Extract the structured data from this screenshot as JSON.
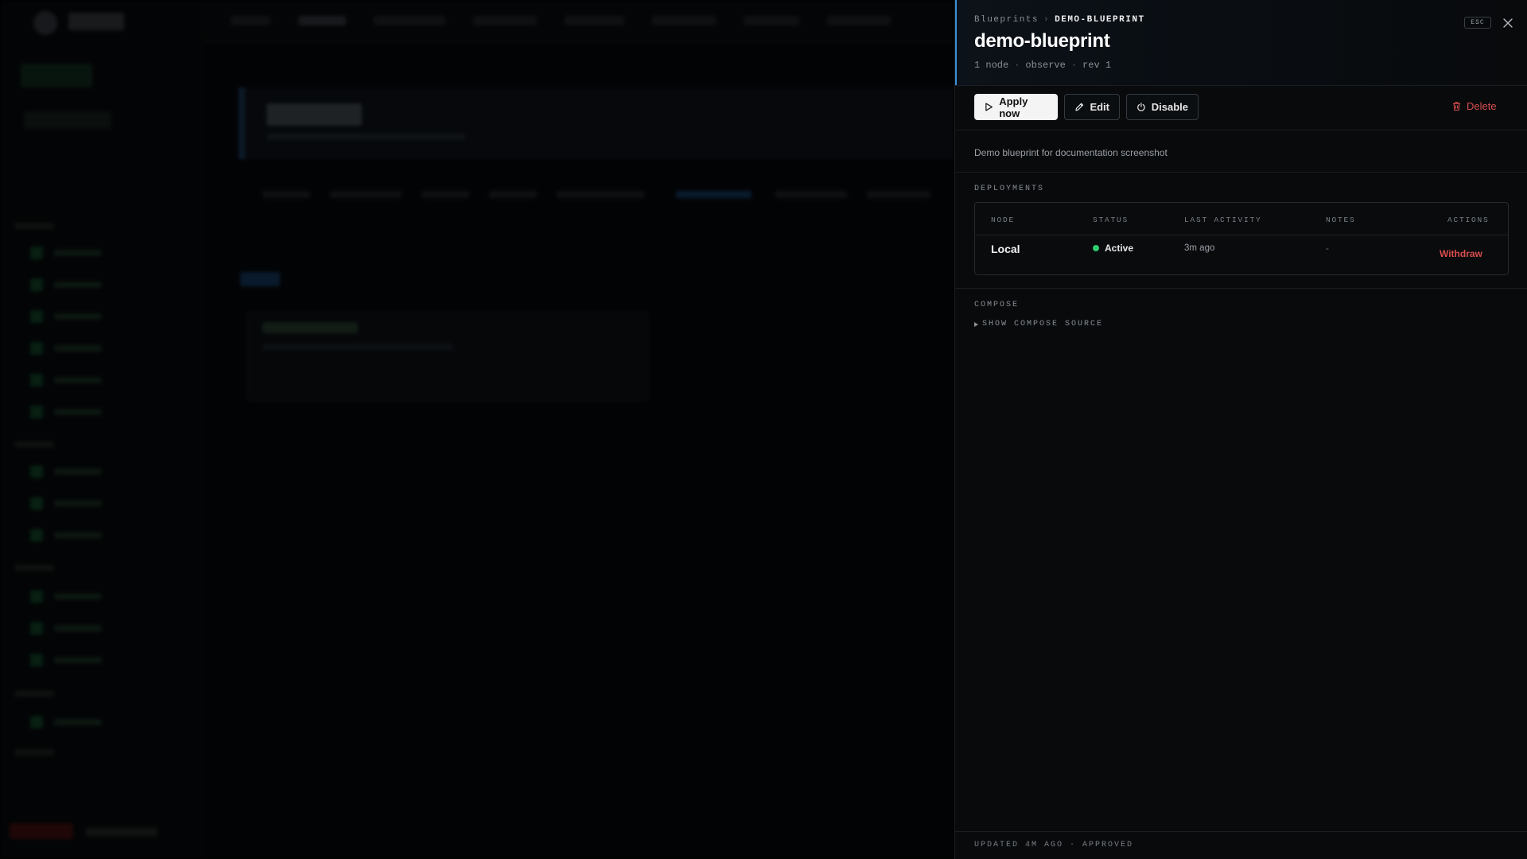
{
  "breadcrumb": {
    "parent": "Blueprints",
    "separator": "›",
    "current": "DEMO-BLUEPRINT"
  },
  "esc_hint": "ESC",
  "title": "demo-blueprint",
  "meta": {
    "nodes": "1 node",
    "mode": "observe",
    "revision": "rev 1",
    "separator": "·"
  },
  "actions": {
    "apply_label": "Apply now",
    "edit_label": "Edit",
    "disable_label": "Disable",
    "delete_label": "Delete"
  },
  "description": "Demo blueprint for documentation screenshot",
  "deployments": {
    "section_label": "DEPLOYMENTS",
    "columns": [
      "NODE",
      "STATUS",
      "LAST ACTIVITY",
      "NOTES",
      "ACTIONS"
    ],
    "rows": [
      {
        "node": "Local",
        "status": "Active",
        "last_activity": "3m ago",
        "notes": "-",
        "action": "Withdraw"
      }
    ]
  },
  "compose": {
    "section_label": "COMPOSE",
    "toggle_label": "SHOW COMPOSE SOURCE"
  },
  "footer": "UPDATED 4M AGO · APPROVED",
  "colors": {
    "accent": "#3b8fd8",
    "danger": "#d84e4e",
    "status_active": "#2ecc71"
  }
}
